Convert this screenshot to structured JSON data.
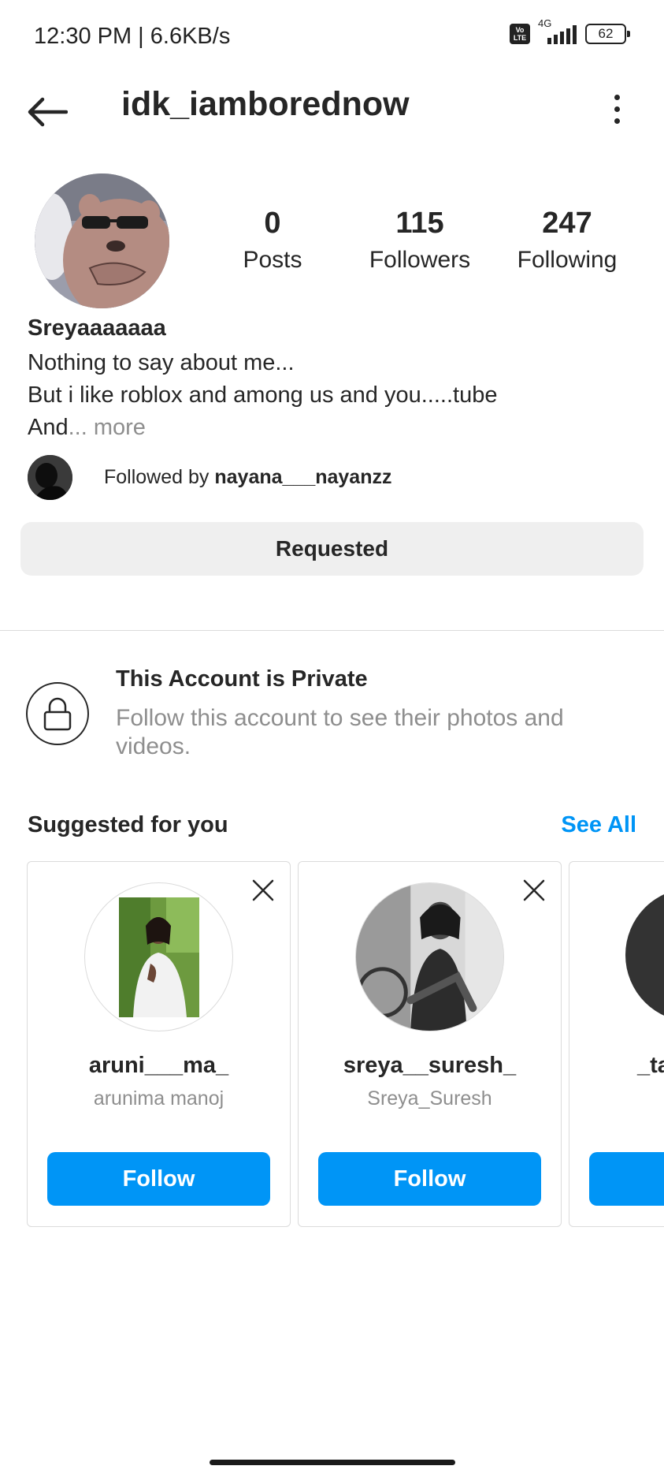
{
  "status_bar": {
    "time": "12:30 PM | 6.6KB/s",
    "volte": "Vo LTE",
    "network": "4G",
    "battery": "62"
  },
  "header": {
    "username": "idk_iamborednow",
    "back_icon": "arrow-left-icon",
    "menu_icon": "more-vertical-icon"
  },
  "profile": {
    "stats": [
      {
        "value": "0",
        "label": "Posts"
      },
      {
        "value": "115",
        "label": "Followers"
      },
      {
        "value": "247",
        "label": "Following"
      }
    ],
    "display_name": "Sreyaaaaaaa",
    "bio_line1": "Nothing to say about me...",
    "bio_line2": "But i like roblox and among us and you.....tube",
    "bio_line3": "And",
    "bio_more": "... more",
    "followed_by_prefix": "Followed by ",
    "followed_by_user": "nayana___nayanzz",
    "requested_label": "Requested"
  },
  "private": {
    "title": "This Account is Private",
    "subtitle": "Follow this account to see their photos and videos.",
    "icon": "lock-icon"
  },
  "suggested": {
    "title": "Suggested for you",
    "see_all": "See All",
    "cards": [
      {
        "username": "aruni___ma_",
        "full_name": "arunima manoj",
        "button": "Follow"
      },
      {
        "username": "sreya__suresh_",
        "full_name": "Sreya_Suresh",
        "button": "Follow"
      },
      {
        "username": "_ta",
        "full_name": "",
        "button": ""
      }
    ]
  },
  "colors": {
    "accent": "#0095f6",
    "text": "#262626",
    "muted": "#8e8e8e",
    "button_bg": "#efefef",
    "border": "#dbdbdb"
  }
}
